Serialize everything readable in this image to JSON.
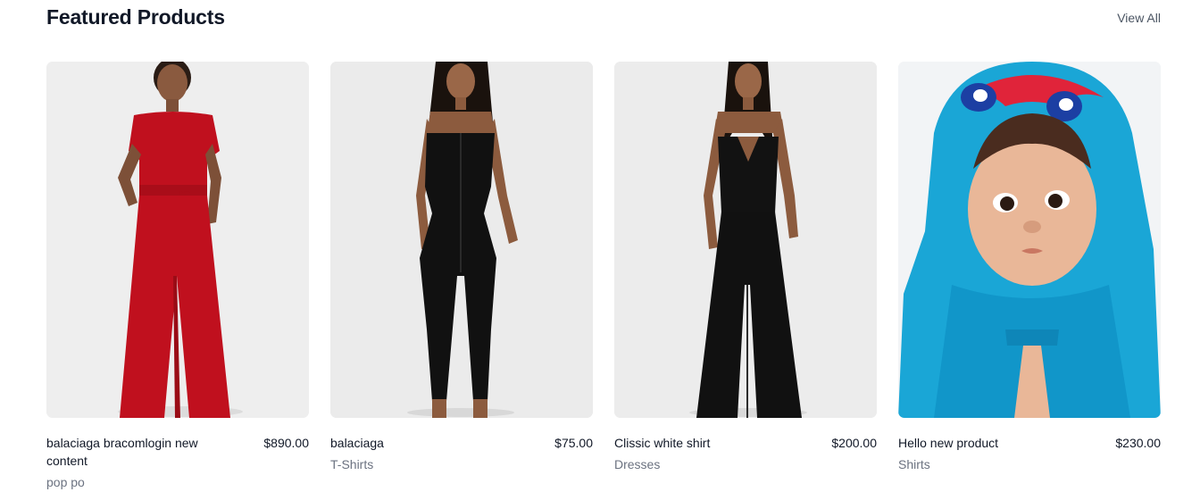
{
  "section": {
    "title": "Featured Products",
    "view_all_label": "View All"
  },
  "products": [
    {
      "name": "balaciaga bracomlogin new content",
      "price": "$890.00",
      "category": "pop po",
      "image": "woman-red-jumpsuit",
      "color": "#c0101e"
    },
    {
      "name": "balaciaga",
      "price": "$75.00",
      "category": "T-Shirts",
      "image": "woman-black-bodysuit",
      "color": "#111111"
    },
    {
      "name": "Clissic white shirt",
      "price": "$200.00",
      "category": "Dresses",
      "image": "woman-black-jumpsuit",
      "color": "#111111"
    },
    {
      "name": "Hello new product",
      "price": "$230.00",
      "category": "Shirts",
      "image": "baby-blue-hooded-robe",
      "color": "#1aa6d6"
    }
  ]
}
